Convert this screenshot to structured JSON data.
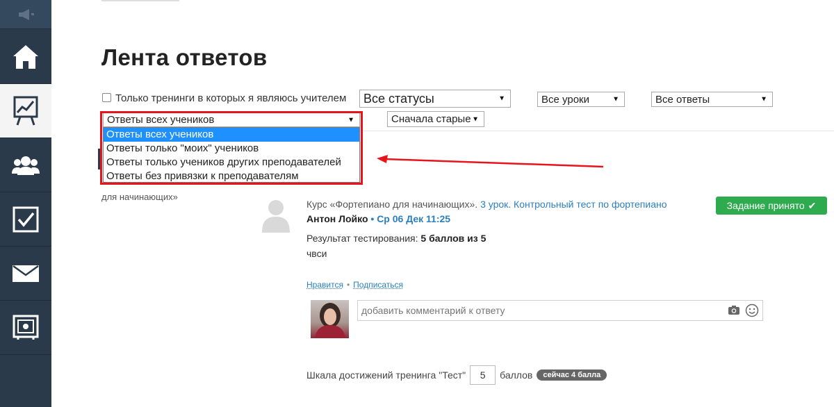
{
  "sidebar": {
    "items": [
      {
        "icon": "megaphone-icon"
      },
      {
        "icon": "home-icon"
      },
      {
        "icon": "chart-board-icon",
        "active": true
      },
      {
        "icon": "users-icon"
      },
      {
        "icon": "checkbox-icon"
      },
      {
        "icon": "envelope-icon"
      },
      {
        "icon": "safe-icon"
      }
    ]
  },
  "page": {
    "title": "Лента ответов"
  },
  "filters": {
    "teacher_only_label": "Только тренинги в которых я являюсь учителем",
    "status_select": "Все статусы",
    "lessons_select": "Все уроки",
    "answers_select": "Все ответы",
    "students_select": "Ответы всех учеников",
    "order_select": "Сначала старые",
    "students_options": [
      "Ответы всех учеников",
      "Ответы только \"моих\" учеников",
      "Ответы только учеников других преподавателей",
      "Ответы без привязки к преподавателям"
    ]
  },
  "left_panel": {
    "text": "для начинающих»"
  },
  "post": {
    "course_prefix": "Курс «Фортепиано для начинающих».",
    "lesson_link": "3 урок. Контрольный тест по фортепиано",
    "author": "Антон Лойко",
    "bullet": " • ",
    "datetime": "Ср 06 Дек 11:25",
    "status_label": "Задание принято",
    "result_label": "Результат тестирования:",
    "result_value": "5 баллов из 5",
    "answer_text": "чвси",
    "like_label": "Нравится",
    "subscribe_label": "Подписаться",
    "comment_placeholder": "добавить комментарий к ответу",
    "scale_prefix": "Шкала достижений тренинга \"Тест\"",
    "scale_value": "5",
    "scale_suffix": "баллов",
    "now_badge": "сейчас 4 балла"
  },
  "colors": {
    "sidebar_bg": "#2b3a4a",
    "accent_link": "#2a7fbf",
    "success": "#2eaa4f",
    "highlight_red": "#e8141b",
    "selection_blue": "#1e90ff"
  }
}
